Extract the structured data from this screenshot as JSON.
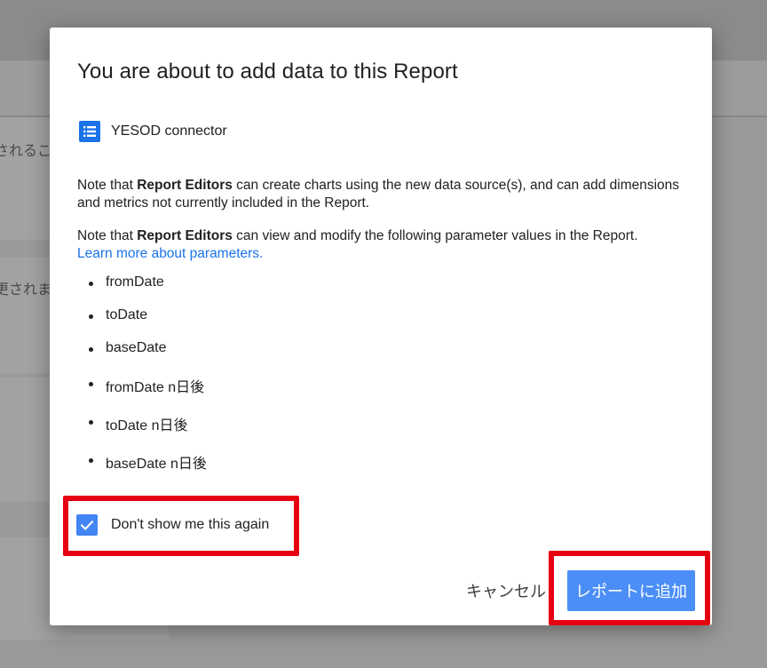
{
  "background": {
    "snippets": [
      "されるこ",
      "更されま"
    ]
  },
  "dialog": {
    "title": "You are about to add data to this Report",
    "source": {
      "icon": "list-icon",
      "name": "YESOD connector"
    },
    "note1": {
      "prefix": "Note that ",
      "bold": "Report Editors",
      "suffix": " can create charts using the new data source(s), and can add dimensions and metrics not currently included in the Report."
    },
    "note2": {
      "prefix": "Note that ",
      "bold": "Report Editors",
      "suffix": " can view and modify the following parameter values in the Report.",
      "link": "Learn more about parameters."
    },
    "parameters": [
      "fromDate",
      "toDate",
      "baseDate",
      "fromDate n日後",
      "toDate n日後",
      "baseDate n日後"
    ],
    "checkbox": {
      "label": "Don't show me this again",
      "checked": true
    },
    "buttons": {
      "cancel": "キャンセル",
      "add": "レポートに追加"
    }
  },
  "colors": {
    "accent": "#4285f4",
    "link": "#1a73e8",
    "highlight": "#e60012",
    "overlay": "#9a9a9a"
  }
}
